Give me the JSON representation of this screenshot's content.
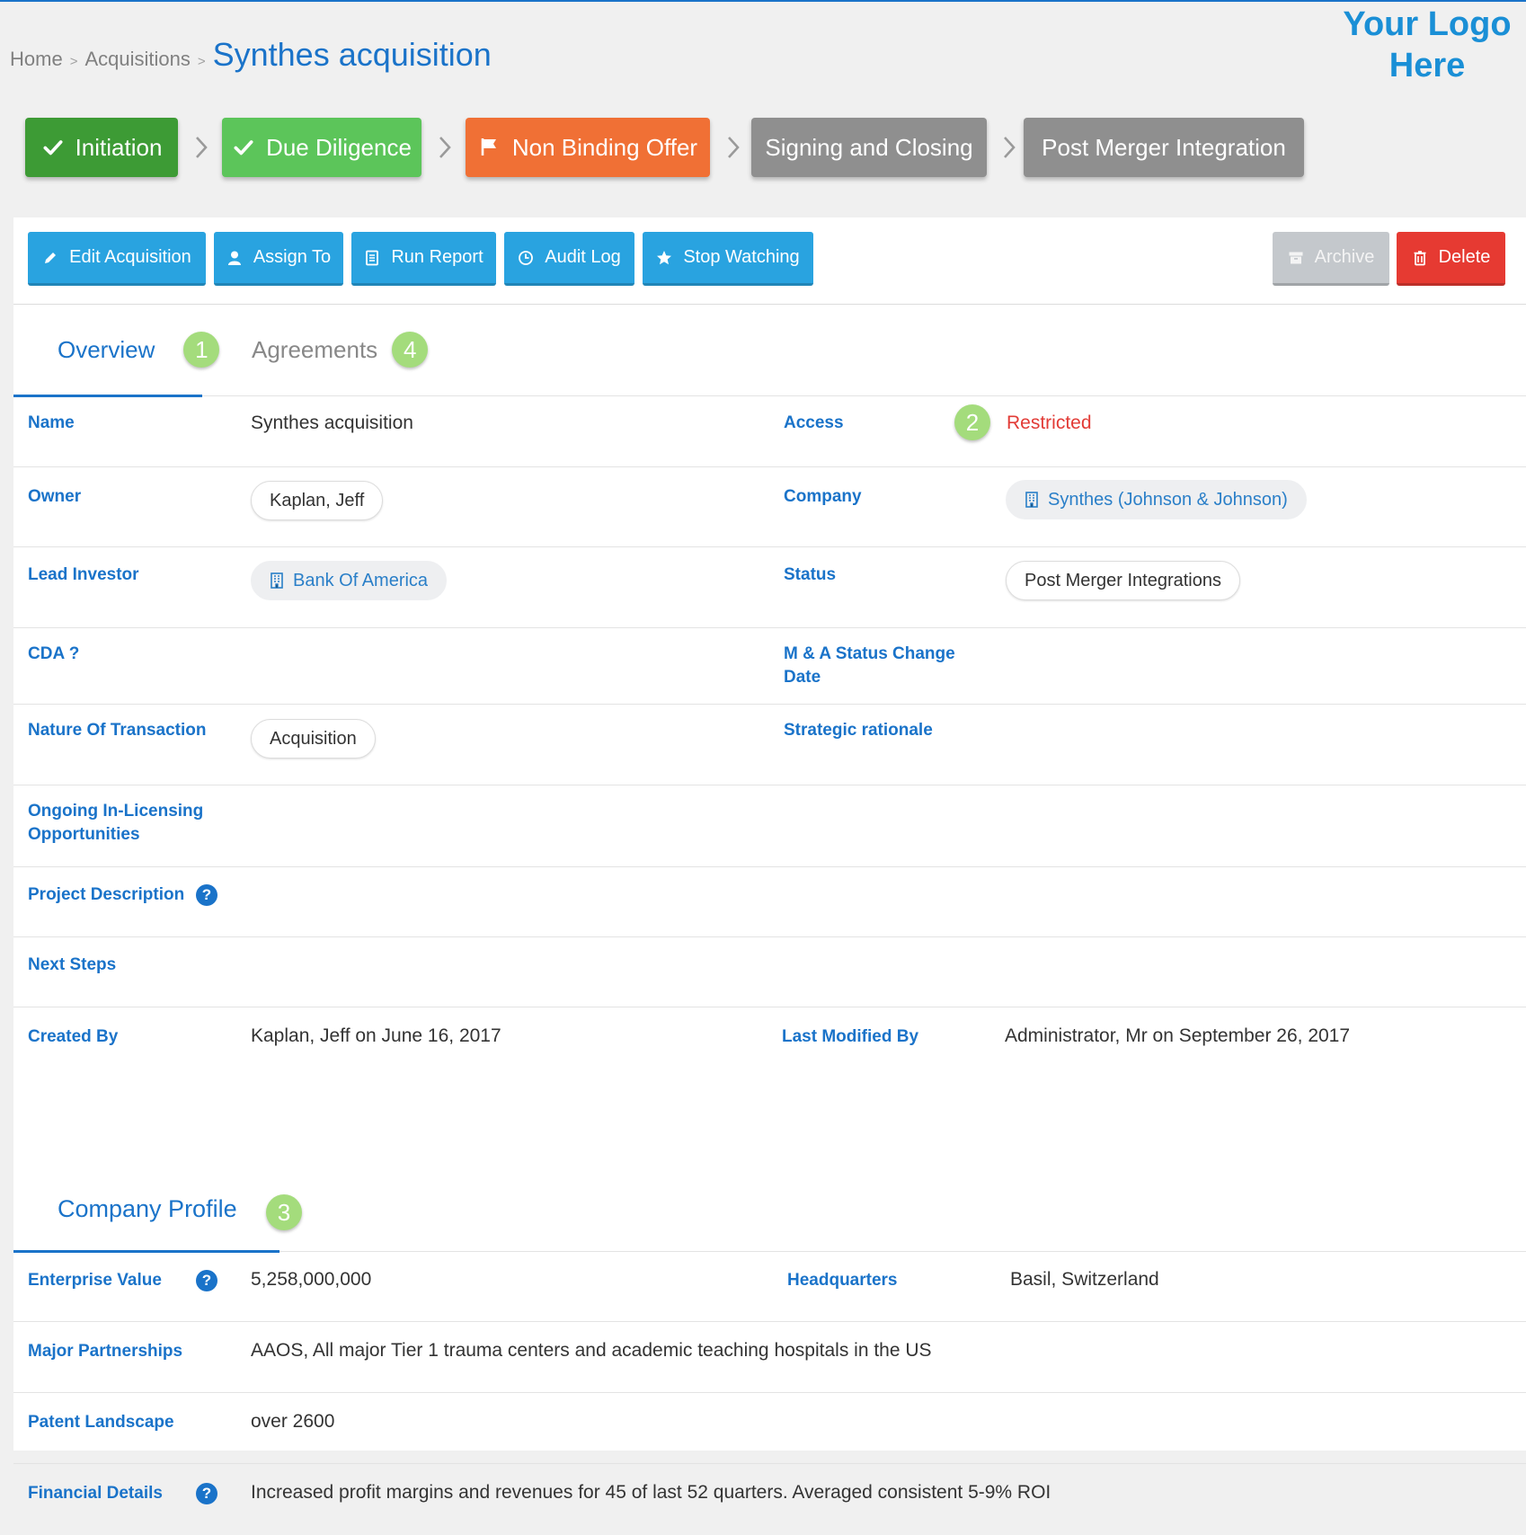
{
  "breadcrumb": {
    "home": "Home",
    "section": "Acquisitions",
    "separator": ">",
    "current": "Synthes acquisition"
  },
  "logo": {
    "line1": "Your Logo",
    "line2": "Here"
  },
  "stages": [
    {
      "label": "Initiation",
      "state": "completed",
      "icon": "check-icon",
      "color": "#3d9b35"
    },
    {
      "label": "Due Diligence",
      "state": "completed",
      "icon": "check-icon",
      "color": "#5cc55a"
    },
    {
      "label": "Non Binding Offer",
      "state": "current",
      "icon": "flag-icon",
      "color": "#f07035"
    },
    {
      "label": "Signing and Closing",
      "state": "pending",
      "icon": "",
      "color": "#8f8f8f"
    },
    {
      "label": "Post Merger Integration",
      "state": "pending",
      "icon": "",
      "color": "#8f8f8f"
    }
  ],
  "toolbar": {
    "edit": "Edit Acquisition",
    "assign": "Assign To",
    "report": "Run Report",
    "audit": "Audit Log",
    "watch": "Stop Watching",
    "archive": "Archive",
    "delete": "Delete"
  },
  "tabs": {
    "overview": {
      "label": "Overview",
      "badge": "1"
    },
    "agreements": {
      "label": "Agreements",
      "badge": "4"
    }
  },
  "fields": {
    "name": {
      "label": "Name",
      "value": "Synthes acquisition"
    },
    "access": {
      "label": "Access",
      "badge": "2",
      "value": "Restricted"
    },
    "owner": {
      "label": "Owner",
      "value": "Kaplan, Jeff"
    },
    "company": {
      "label": "Company",
      "value": "Synthes (Johnson & Johnson)"
    },
    "lead_investor": {
      "label": "Lead Investor",
      "value": "Bank Of America"
    },
    "status": {
      "label": "Status",
      "value": "Post Merger Integrations"
    },
    "cda": {
      "label": "CDA ?"
    },
    "ma_status_change": {
      "label_line1": "M & A Status Change",
      "label_line2": "Date"
    },
    "nature": {
      "label": "Nature Of Transaction",
      "value": "Acquisition"
    },
    "strategic": {
      "label": "Strategic rationale"
    },
    "ongoing": {
      "label_line1": "Ongoing In-Licensing",
      "label_line2": "Opportunities"
    },
    "project_description": {
      "label": "Project Description"
    },
    "next_steps": {
      "label": "Next Steps"
    },
    "created_by": {
      "label": "Created By",
      "value": "Kaplan, Jeff on June 16, 2017"
    },
    "last_modified_by": {
      "label": "Last Modified By",
      "value": "Administrator, Mr on September 26, 2017"
    }
  },
  "company_profile": {
    "title": "Company Profile",
    "badge": "3",
    "enterprise_value": {
      "label": "Enterprise Value",
      "value": "5,258,000,000"
    },
    "headquarters": {
      "label": "Headquarters",
      "value": "Basil, Switzerland"
    },
    "major_partnerships": {
      "label": "Major Partnerships",
      "value": "AAOS, All major Tier 1 trauma centers and academic teaching hospitals in the US"
    },
    "patent_landscape": {
      "label": "Patent Landscape",
      "value": "over 2600"
    },
    "financial_details": {
      "label": "Financial Details",
      "value": "Increased profit margins and revenues for 45 of last 52 quarters. Averaged consistent 5-9% ROI"
    }
  },
  "help_glyph": "?"
}
